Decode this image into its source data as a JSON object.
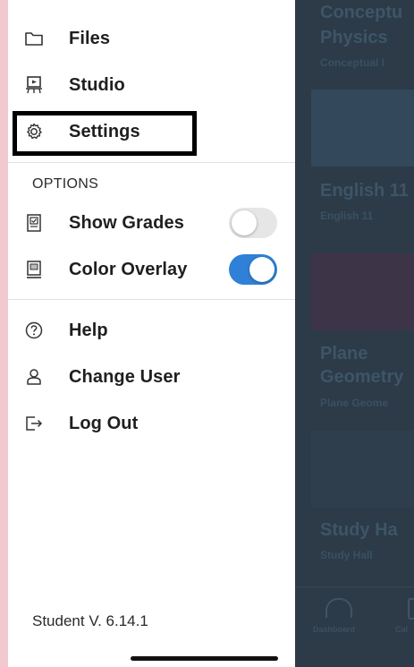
{
  "drawer": {
    "items": [
      {
        "label": "Files",
        "icon": "folder-icon"
      },
      {
        "label": "Studio",
        "icon": "studio-icon"
      },
      {
        "label": "Settings",
        "icon": "gear-icon"
      }
    ],
    "options_header": "OPTIONS",
    "options": [
      {
        "label": "Show Grades",
        "icon": "grades-icon",
        "enabled": false
      },
      {
        "label": "Color Overlay",
        "icon": "color-overlay-icon",
        "enabled": true
      }
    ],
    "bottom_items": [
      {
        "label": "Help",
        "icon": "help-icon"
      },
      {
        "label": "Change User",
        "icon": "user-icon"
      },
      {
        "label": "Log Out",
        "icon": "logout-icon"
      }
    ],
    "version": "Student V. 6.14.1"
  },
  "background": {
    "courses": [
      {
        "title_1": "Conceptu",
        "title_2": "Physics",
        "subtitle": "Conceptual I"
      },
      {
        "title_1": "English 11",
        "subtitle": "English 11"
      },
      {
        "title_1": "Plane",
        "title_2": "Geometry",
        "subtitle": "Plane Geome"
      },
      {
        "title_1": "Study Ha",
        "subtitle": "Study Hall"
      }
    ],
    "tabs": [
      {
        "label": "Dashboard"
      },
      {
        "label": "Cal"
      }
    ]
  },
  "colors": {
    "accent": "#2f80d6",
    "toggle_off": "#e6e6e6",
    "backdrop": "#2c3b47",
    "page_border": "#f2c9ce"
  }
}
